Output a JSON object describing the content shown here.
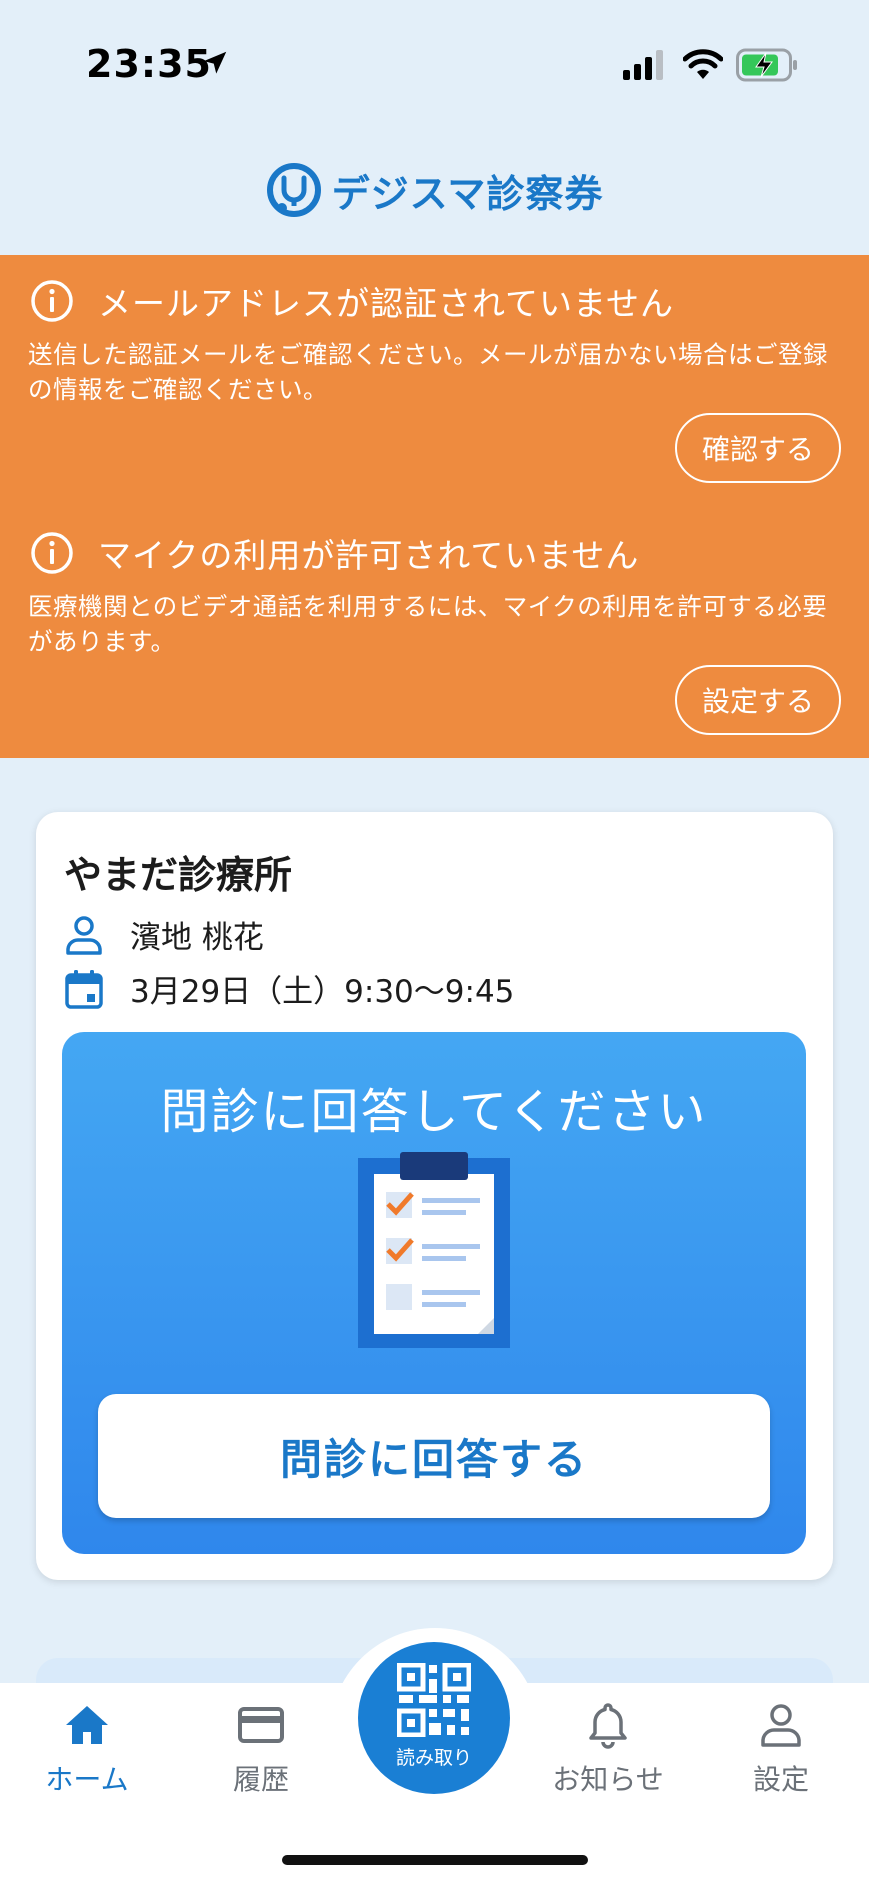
{
  "status_bar": {
    "time": "23:35"
  },
  "app": {
    "title": "デジスマ診察券",
    "brand_color": "#1a78c8"
  },
  "alerts": [
    {
      "title": "メールアドレスが認証されていません",
      "body": "送信した認証メールをご確認ください。メールが届かない場合はご登録の情報をご確認ください。",
      "button": "確認する"
    },
    {
      "title": "マイクの利用が許可されていません",
      "body": "医療機関とのビデオ通話を利用するには、マイクの利用を許可する必要があります。",
      "button": "設定する"
    }
  ],
  "alert_color": "#ee8b3f",
  "appointment": {
    "clinic": "やまだ診療所",
    "patient": "濱地 桃花",
    "datetime": "3月29日（土）9:30〜9:45",
    "questionnaire_prompt": "問診に回答してください",
    "questionnaire_button": "問診に回答する"
  },
  "tabbar": {
    "items": [
      {
        "label": "ホーム",
        "icon": "home-icon",
        "active": true
      },
      {
        "label": "履歴",
        "icon": "card-icon",
        "active": false
      },
      {
        "label": "お知らせ",
        "icon": "bell-icon",
        "active": false
      },
      {
        "label": "設定",
        "icon": "person-icon",
        "active": false
      }
    ],
    "scan_label": "読み取り"
  }
}
